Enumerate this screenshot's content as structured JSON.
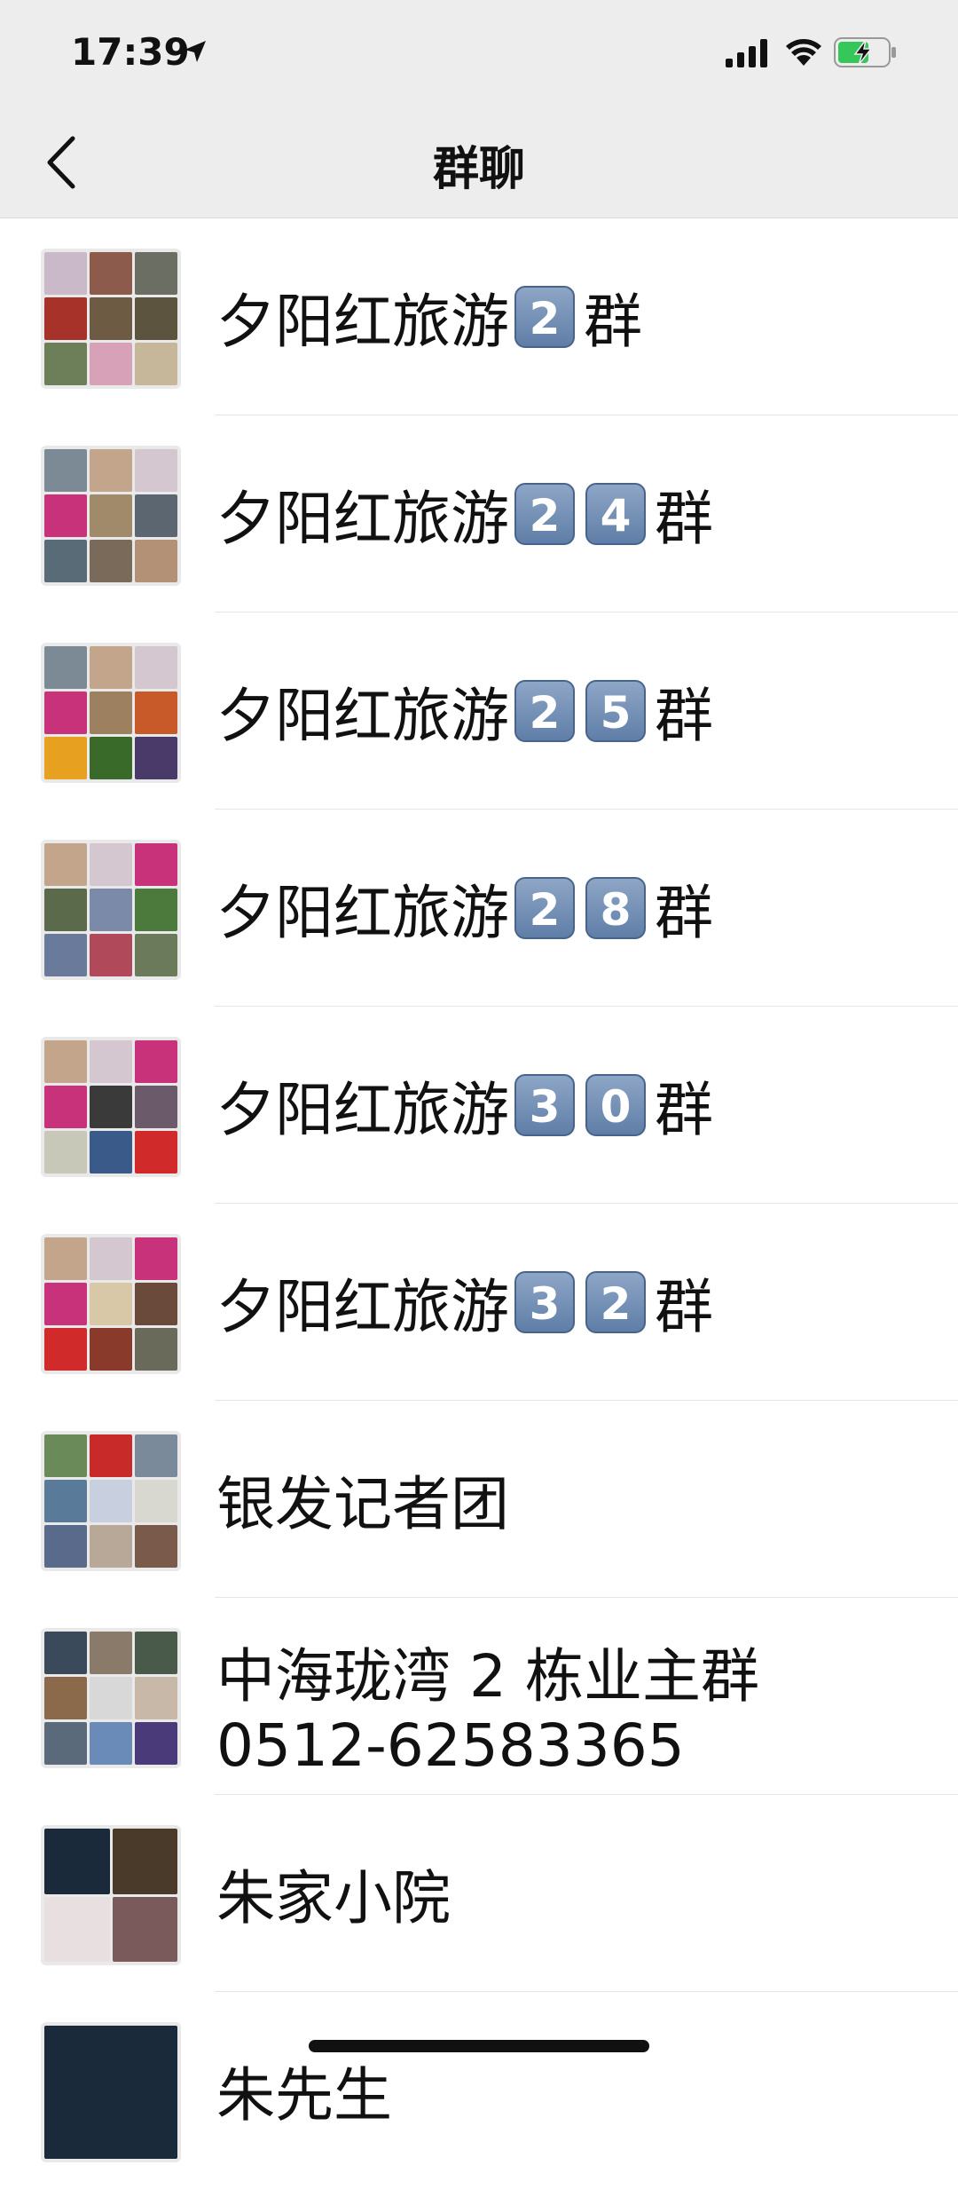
{
  "status": {
    "time": "17:39"
  },
  "nav": {
    "title": "群聊"
  },
  "groups": [
    {
      "prefix": "夕阳红旅游",
      "digits": [
        "2"
      ],
      "suffix": "群"
    },
    {
      "prefix": "夕阳红旅游",
      "digits": [
        "2",
        "4"
      ],
      "suffix": "群"
    },
    {
      "prefix": "夕阳红旅游",
      "digits": [
        "2",
        "5"
      ],
      "suffix": "群"
    },
    {
      "prefix": "夕阳红旅游",
      "digits": [
        "2",
        "8"
      ],
      "suffix": "群"
    },
    {
      "prefix": "夕阳红旅游",
      "digits": [
        "3",
        "0"
      ],
      "suffix": "群"
    },
    {
      "prefix": "夕阳红旅游",
      "digits": [
        "3",
        "2"
      ],
      "suffix": "群"
    }
  ],
  "others": [
    {
      "line1": "银发记者团"
    },
    {
      "line1": "中海珑湾 2 栋业主群",
      "line2": "0512-62583365"
    },
    {
      "line1": "朱家小院"
    },
    {
      "line1": "朱先生"
    }
  ]
}
